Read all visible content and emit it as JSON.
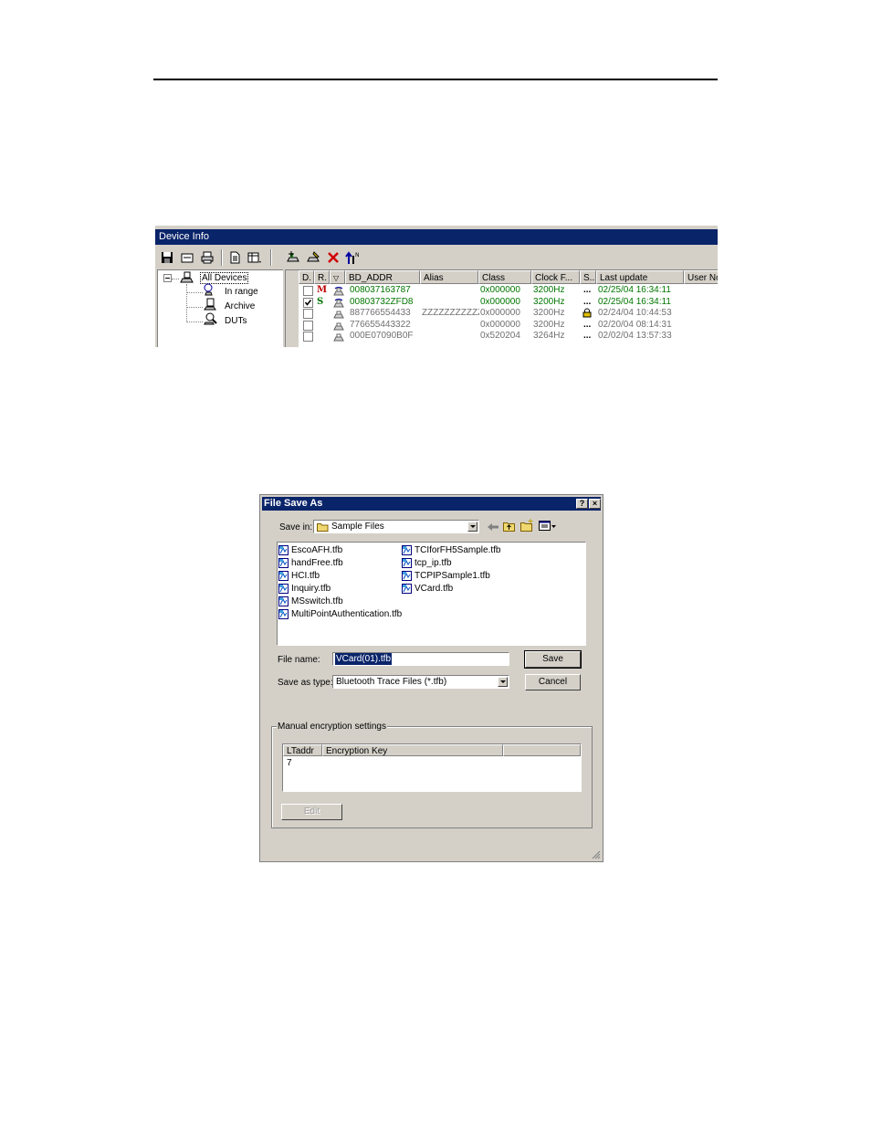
{
  "device_info": {
    "title": "Device Info",
    "tree": {
      "root": "All Devices",
      "children": [
        "In range",
        "Archive",
        "DUTs"
      ]
    },
    "columns": [
      "D.",
      "R.",
      "",
      "BD_ADDR",
      "Alias",
      "Class",
      "Clock F...",
      "S..",
      "Last update",
      "User No"
    ],
    "rows": [
      {
        "role": "M",
        "checked": false,
        "addr": "008037163787",
        "alias": "",
        "class": "0x000000",
        "clock": "3200Hz",
        "status": "...",
        "updated": "02/25/04 16:34:11",
        "color": "green"
      },
      {
        "role": "S",
        "checked": true,
        "addr": "00803732ZFD8",
        "alias": "",
        "class": "0x000000",
        "clock": "3200Hz",
        "status": "...",
        "updated": "02/25/04 16:34:11",
        "color": "green"
      },
      {
        "role": "",
        "checked": false,
        "addr": "887766554433",
        "alias": "ZZZZZZZZZZZ",
        "class": "0x000000",
        "clock": "3200Hz",
        "status": "lock",
        "updated": "02/24/04 10:44:53",
        "color": "gray"
      },
      {
        "role": "",
        "checked": false,
        "addr": "776655443322",
        "alias": "",
        "class": "0x000000",
        "clock": "3200Hz",
        "status": "...",
        "updated": "02/20/04 08:14:31",
        "color": "gray"
      },
      {
        "role": "",
        "checked": false,
        "addr": "000E07090B0F",
        "alias": "",
        "class": "0x520204",
        "clock": "3264Hz",
        "status": "...",
        "updated": "02/02/04 13:57:33",
        "color": "gray"
      }
    ]
  },
  "file_save_dialog": {
    "title": "File Save As",
    "help_button": "?",
    "close_button": "×",
    "save_in_label": "Save in:",
    "save_in_value": "Sample Files",
    "files": [
      "EscoAFH.tfb",
      "handFree.tfb",
      "HCI.tfb",
      "Inquiry.tfb",
      "MSswitch.tfb",
      "MultiPointAuthentication.tfb",
      "TCIforFH5Sample.tfb",
      "tcp_ip.tfb",
      "TCPIPSample1.tfb",
      "VCard.tfb"
    ],
    "file_name_label": "File name:",
    "file_name_value": "VCard(01).tfb",
    "save_as_type_label": "Save as type:",
    "save_as_type_value": "Bluetooth Trace Files (*.tfb)",
    "save_button": "Save",
    "cancel_button": "Cancel",
    "group_label": "Manual encryption settings",
    "table_columns": [
      "LTaddr",
      "Encryption Key"
    ],
    "table_first_cell": "7",
    "edit_button": "Edit"
  }
}
